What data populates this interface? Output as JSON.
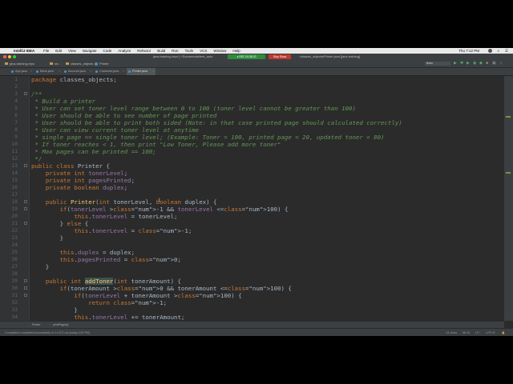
{
  "menubar": {
    "app_name": "IntelliJ IDEA",
    "items": [
      "File",
      "Edit",
      "View",
      "Navigate",
      "Code",
      "Analyze",
      "Refactor",
      "Build",
      "Run",
      "Tools",
      "VCS",
      "Window",
      "Help"
    ],
    "clock": "Thu 7:12 PM"
  },
  "window": {
    "title_left": "java-training-repo [~/Documents/test_auto",
    "title_right": "/classes_objects/Printer.java [java-training]",
    "notification_green": "● REC 00:38:22",
    "notification_red": "Stop Show"
  },
  "navbar": {
    "project": "java-training-repo",
    "folder1": "src",
    "folder2": "classes_objects",
    "file": "Printer",
    "run_config": "Bank"
  },
  "tabs": [
    {
      "label": "App.java",
      "active": false
    },
    {
      "label": "Bank.java",
      "active": false
    },
    {
      "label": "Account.java",
      "active": false
    },
    {
      "label": "Customer.java",
      "active": false
    },
    {
      "label": "Printer.java",
      "active": true
    }
  ],
  "editor": {
    "lines": [
      "package classes_objects;",
      "",
      "/**",
      " * Build a printer",
      " * User can set toner level range between 0 to 100 (toner level cannot be greater than 100)",
      " * User should be able to see number of page printed",
      " * User should be able to print both sided (Note: in that case printed page should calculated correctly)",
      " * User can view current toner level at anytime",
      " * single page == single toner level; (Example: Toner = 100, printed page = 20, updated toner = 80)",
      " * If toner reaches < 1, then print \"Low Toner, Please add more toner\"",
      " * Max pages can be printed == 100;",
      " */",
      "public class Printer {",
      "    private int tonerLevel;",
      "    private int pagesPrinted;",
      "    private boolean duplex;",
      "",
      "    public Printer(int tonerLevel, boolean duplex) {",
      "        if(tonerLevel >-1 && tonerLevel <=100) {",
      "            this.tonerLevel = tonerLevel;",
      "        } else {",
      "            this.tonerLevel = -1;",
      "        }",
      "",
      "        this.duplex = duplex;",
      "        this.pagesPrinted = 0;",
      "    }",
      "",
      "    public int addToner(int tonerAmount) {",
      "        if(tonerAmount >0 && tonerAmount <=100) {",
      "            if(tonerLevel + tonerAmount >100) {",
      "                return -1;",
      "            }",
      "            this.tonerLevel += tonerAmount;"
    ]
  },
  "breadcrumb": {
    "class": "Printer",
    "method": "printPages()"
  },
  "statusbar": {
    "message": "Compilation completed successfully in 3 s 971 ms (today 4:00 PM)",
    "chars": "24 chars",
    "position": "68:15",
    "line_sep": "LF÷",
    "encoding": "UTF-8÷"
  },
  "colors": {
    "editor_bg": "#2b2b2b",
    "keyword": "#cc7832",
    "field": "#9876aa",
    "number": "#6897bb",
    "doc_comment": "#629755",
    "method": "#ffc66d",
    "plain": "#a9b7c6"
  }
}
